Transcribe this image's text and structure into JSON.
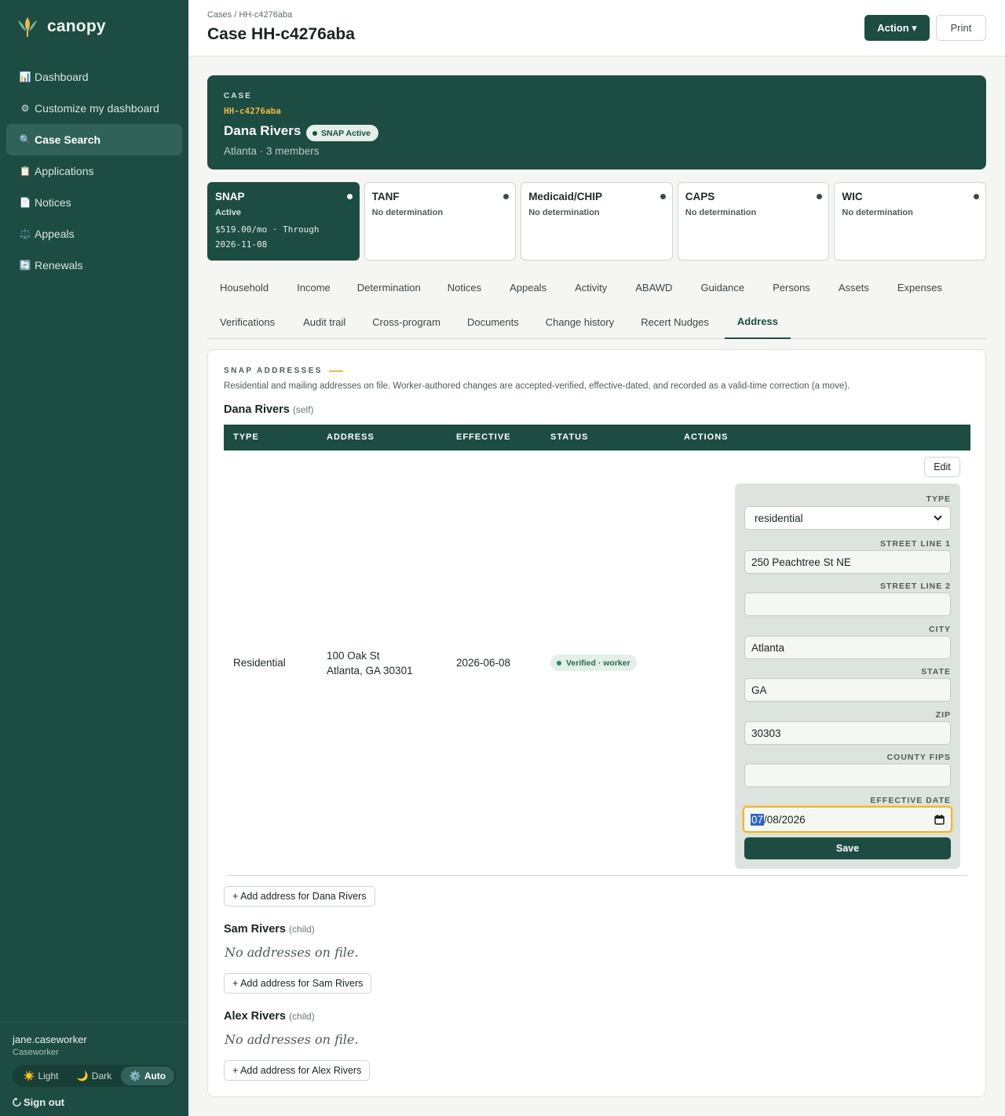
{
  "app": {
    "name": "canopy"
  },
  "sidebar": {
    "items": [
      {
        "icon": "📊",
        "label": "Dashboard"
      },
      {
        "icon": "⚙",
        "label": "Customize my dashboard"
      },
      {
        "icon": "🔍",
        "label": "Case Search"
      },
      {
        "icon": "📋",
        "label": "Applications"
      },
      {
        "icon": "📄",
        "label": "Notices"
      },
      {
        "icon": "⚖️",
        "label": "Appeals"
      },
      {
        "icon": "🔄",
        "label": "Renewals"
      }
    ],
    "active_index": 2,
    "user": {
      "name": "jane.caseworker",
      "role": "Caseworker"
    },
    "theme": [
      {
        "icon": "☀️",
        "label": "Light"
      },
      {
        "icon": "🌙",
        "label": "Dark"
      },
      {
        "icon": "⚙️",
        "label": "Auto"
      }
    ],
    "theme_active": "Auto",
    "signout_label": "Sign out"
  },
  "header": {
    "breadcrumb": "Cases / HH-c4276aba",
    "title": "Case HH-c4276aba",
    "action_label": "Action ▾",
    "print_label": "Print"
  },
  "hero": {
    "kicker": "CASE",
    "case_id": "HH-c4276aba",
    "name": "Dana Rivers",
    "badge": "SNAP Active",
    "subtitle": "Atlanta · 3 members"
  },
  "programs": [
    {
      "name": "SNAP",
      "status": "Active",
      "detail_line1": "$519.00/mo · Through",
      "detail_line2": "2026-11-08"
    },
    {
      "name": "TANF",
      "status": "No determination"
    },
    {
      "name": "Medicaid/CHIP",
      "status": "No determination"
    },
    {
      "name": "CAPS",
      "status": "No determination"
    },
    {
      "name": "WIC",
      "status": "No determination"
    }
  ],
  "tabs": {
    "row1": [
      "Household",
      "Income",
      "Determination",
      "Notices",
      "Appeals",
      "Activity",
      "ABAWD",
      "Guidance",
      "Persons",
      "Assets",
      "Expenses"
    ],
    "row2": [
      "Verifications",
      "Audit trail",
      "Cross-program",
      "Documents",
      "Change history",
      "Recert Nudges",
      "Address"
    ],
    "active": "Address"
  },
  "addresses": {
    "kicker": "SNAP ADDRESSES",
    "description": "Residential and mailing addresses on file. Worker-authored changes are accepted-verified, effective-dated, and recorded as a valid-time correction (a move).",
    "columns": [
      "TYPE",
      "ADDRESS",
      "EFFECTIVE",
      "STATUS",
      "ACTIONS"
    ],
    "persons": [
      {
        "name": "Dana Rivers",
        "relation": "(self)",
        "add_label": "+ Add address for Dana Rivers"
      },
      {
        "name": "Sam Rivers",
        "relation": "(child)",
        "empty": "No addresses on file.",
        "add_label": "+ Add address for Sam Rivers"
      },
      {
        "name": "Alex Rivers",
        "relation": "(child)",
        "empty": "No addresses on file.",
        "add_label": "+ Add address for Alex Rivers"
      }
    ],
    "row": {
      "type": "Residential",
      "address_line1": "100 Oak St",
      "address_line2": "Atlanta, GA 30301",
      "effective": "2026-06-08",
      "status": "Verified · worker",
      "edit_label": "Edit"
    },
    "form": {
      "type_label": "TYPE",
      "type_value": "residential",
      "street1_label": "STREET LINE 1",
      "street1_value": "250 Peachtree St NE",
      "street2_label": "STREET LINE 2",
      "street2_value": "",
      "city_label": "CITY",
      "city_value": "Atlanta",
      "state_label": "STATE",
      "state_value": "GA",
      "zip_label": "ZIP",
      "zip_value": "30303",
      "county_label": "COUNTY FIPS",
      "county_value": "",
      "date_label": "EFFECTIVE DATE",
      "date_month": "07",
      "date_rest": "/08/2026",
      "save_label": "Save"
    }
  }
}
